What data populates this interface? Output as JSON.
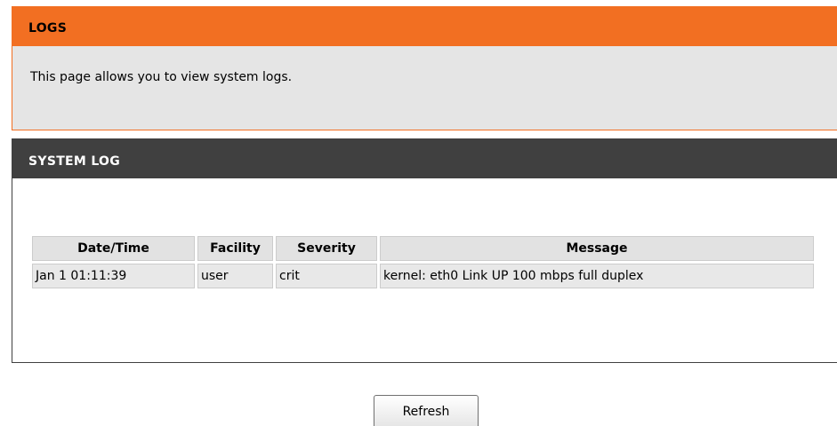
{
  "logs": {
    "title": "LOGS",
    "description": "This page allows you to view system logs."
  },
  "system_log": {
    "title": "SYSTEM LOG",
    "columns": {
      "date_time": "Date/Time",
      "facility": "Facility",
      "severity": "Severity",
      "message": "Message"
    },
    "rows": [
      {
        "date_time": "Jan 1 01:11:39",
        "facility": "user",
        "severity": "crit",
        "message": "kernel: eth0 Link UP 100 mbps full duplex"
      }
    ]
  },
  "actions": {
    "refresh_label": "Refresh"
  },
  "colors": {
    "logs_header": "#f26f22",
    "system_log_header": "#404040",
    "panel_background": "#e5e5e5"
  }
}
